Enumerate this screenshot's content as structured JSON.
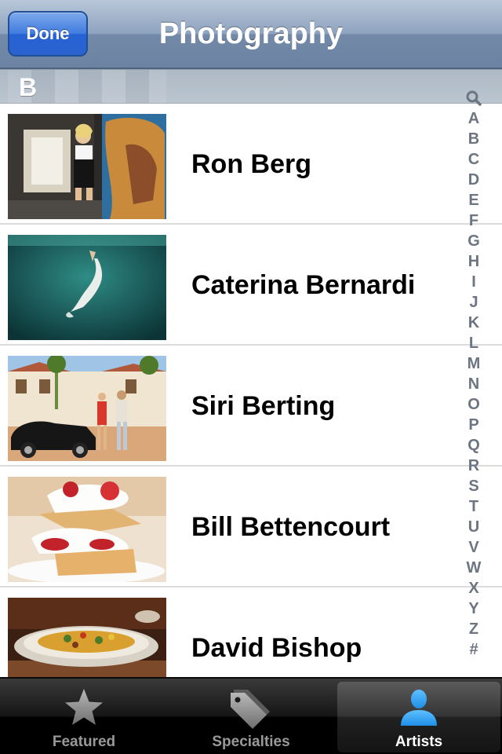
{
  "navbar": {
    "title": "Photography",
    "done_label": "Done"
  },
  "section": {
    "letter": "B"
  },
  "artists": [
    {
      "name": "Ron Berg",
      "thumb": "graffiti-alley-model"
    },
    {
      "name": "Caterina Bernardi",
      "thumb": "underwater-dancer"
    },
    {
      "name": "Siri Berting",
      "thumb": "couple-vintage-car"
    },
    {
      "name": "Bill Bettencourt",
      "thumb": "strawberry-shortcake"
    },
    {
      "name": "David Bishop",
      "thumb": "plated-dish"
    }
  ],
  "index": {
    "search_icon": "search-icon",
    "letters": [
      "A",
      "B",
      "C",
      "D",
      "E",
      "F",
      "G",
      "H",
      "I",
      "J",
      "K",
      "L",
      "M",
      "N",
      "O",
      "P",
      "Q",
      "R",
      "S",
      "T",
      "U",
      "V",
      "W",
      "X",
      "Y",
      "Z",
      "#"
    ]
  },
  "tabbar": {
    "tabs": [
      {
        "label": "Featured",
        "icon": "star-icon"
      },
      {
        "label": "Specialties",
        "icon": "tags-icon"
      },
      {
        "label": "Artists",
        "icon": "person-icon"
      }
    ],
    "active": "Artists",
    "accent": "#1e8fe6"
  }
}
